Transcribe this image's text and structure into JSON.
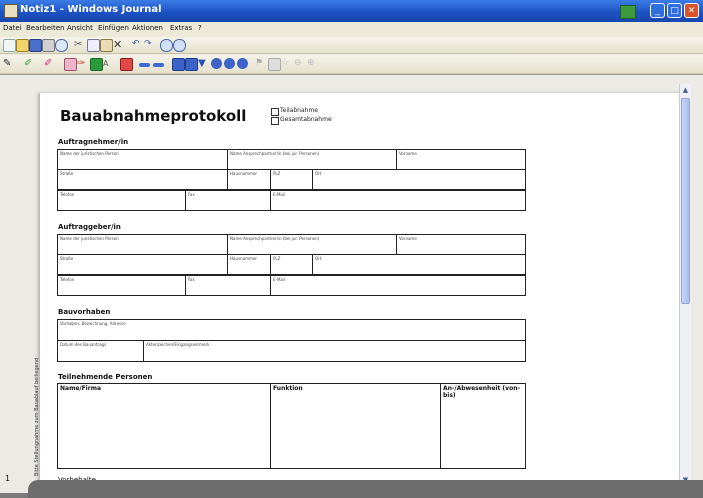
{
  "window": {
    "title": "Notiz1 - Windows Journal",
    "buttons": {
      "minimize": "_",
      "maximize": "□",
      "close": "✕"
    }
  },
  "menu": [
    "Datei",
    "Bearbeiten",
    "Ansicht",
    "Einfügen",
    "Aktionen",
    "Extras",
    "?"
  ],
  "icons": {
    "toolbar1": [
      "new-page-icon",
      "open-icon",
      "save-icon",
      "print-icon",
      "find-icon",
      "cut-icon",
      "copy-icon",
      "paste-icon",
      "delete-icon",
      "undo-icon",
      "redo-icon",
      "zoom-in-icon",
      "zoom-out-icon"
    ],
    "toolbar2": [
      "pen-icon",
      "highlighter-icon",
      "pen-color-icon",
      "eraser-icon",
      "lasso-icon",
      "selection-icon",
      "text-box-icon",
      "flag-icon",
      "insert-space-icon",
      "line-icon",
      "color-fill-icon",
      "shape-icon",
      "circle-icon",
      "bullet-icon",
      "dot-icon",
      "flag-small-icon",
      "rect-icon",
      "star-icon",
      "circle-outline-icon",
      "zoom-icon"
    ]
  },
  "scrollbar": {
    "up": "▲",
    "down": "▼"
  },
  "page_number": "1",
  "vertical_note": "Bitte Stellungnahme zum Bauablauf beiliegend",
  "document": {
    "title": "Bauabnahmeprotokoll",
    "checkbox1": "Teilabnahme",
    "checkbox2": "Gesamtabnahme",
    "sections": {
      "auftragnehmer": "Auftragnehmer/in",
      "auftraggeber": "Auftraggeber/in",
      "bauvorhaben": "Bauvorhaben",
      "teilnehmende": "Teilnehmende Personen",
      "vorbehalte": "Vorbehalte"
    },
    "fields": {
      "firma": "Name der juristischen Person",
      "rechtsform": "Name Ansprechpartner/in (bei jur. Personen)",
      "telefon_nr": "Vorname",
      "strasse": "Straße",
      "hausnummer": "Hausnummer",
      "plz": "PLZ",
      "ort": "Ort",
      "telefon": "Telefon",
      "fax": "Fax",
      "email": "E-Mail",
      "bauvorhaben_adresse": "Vorhaben, Bezeichnung, Adresse",
      "datum": "Datum des Bauantrags",
      "aktenzeichen": "Aktenzeichen/Eingangsvermerk"
    },
    "table_headers": {
      "name": "Name/Firma",
      "funktion": "Funktion",
      "anwesend": "An-/Abwesenheit (von-bis)"
    }
  }
}
